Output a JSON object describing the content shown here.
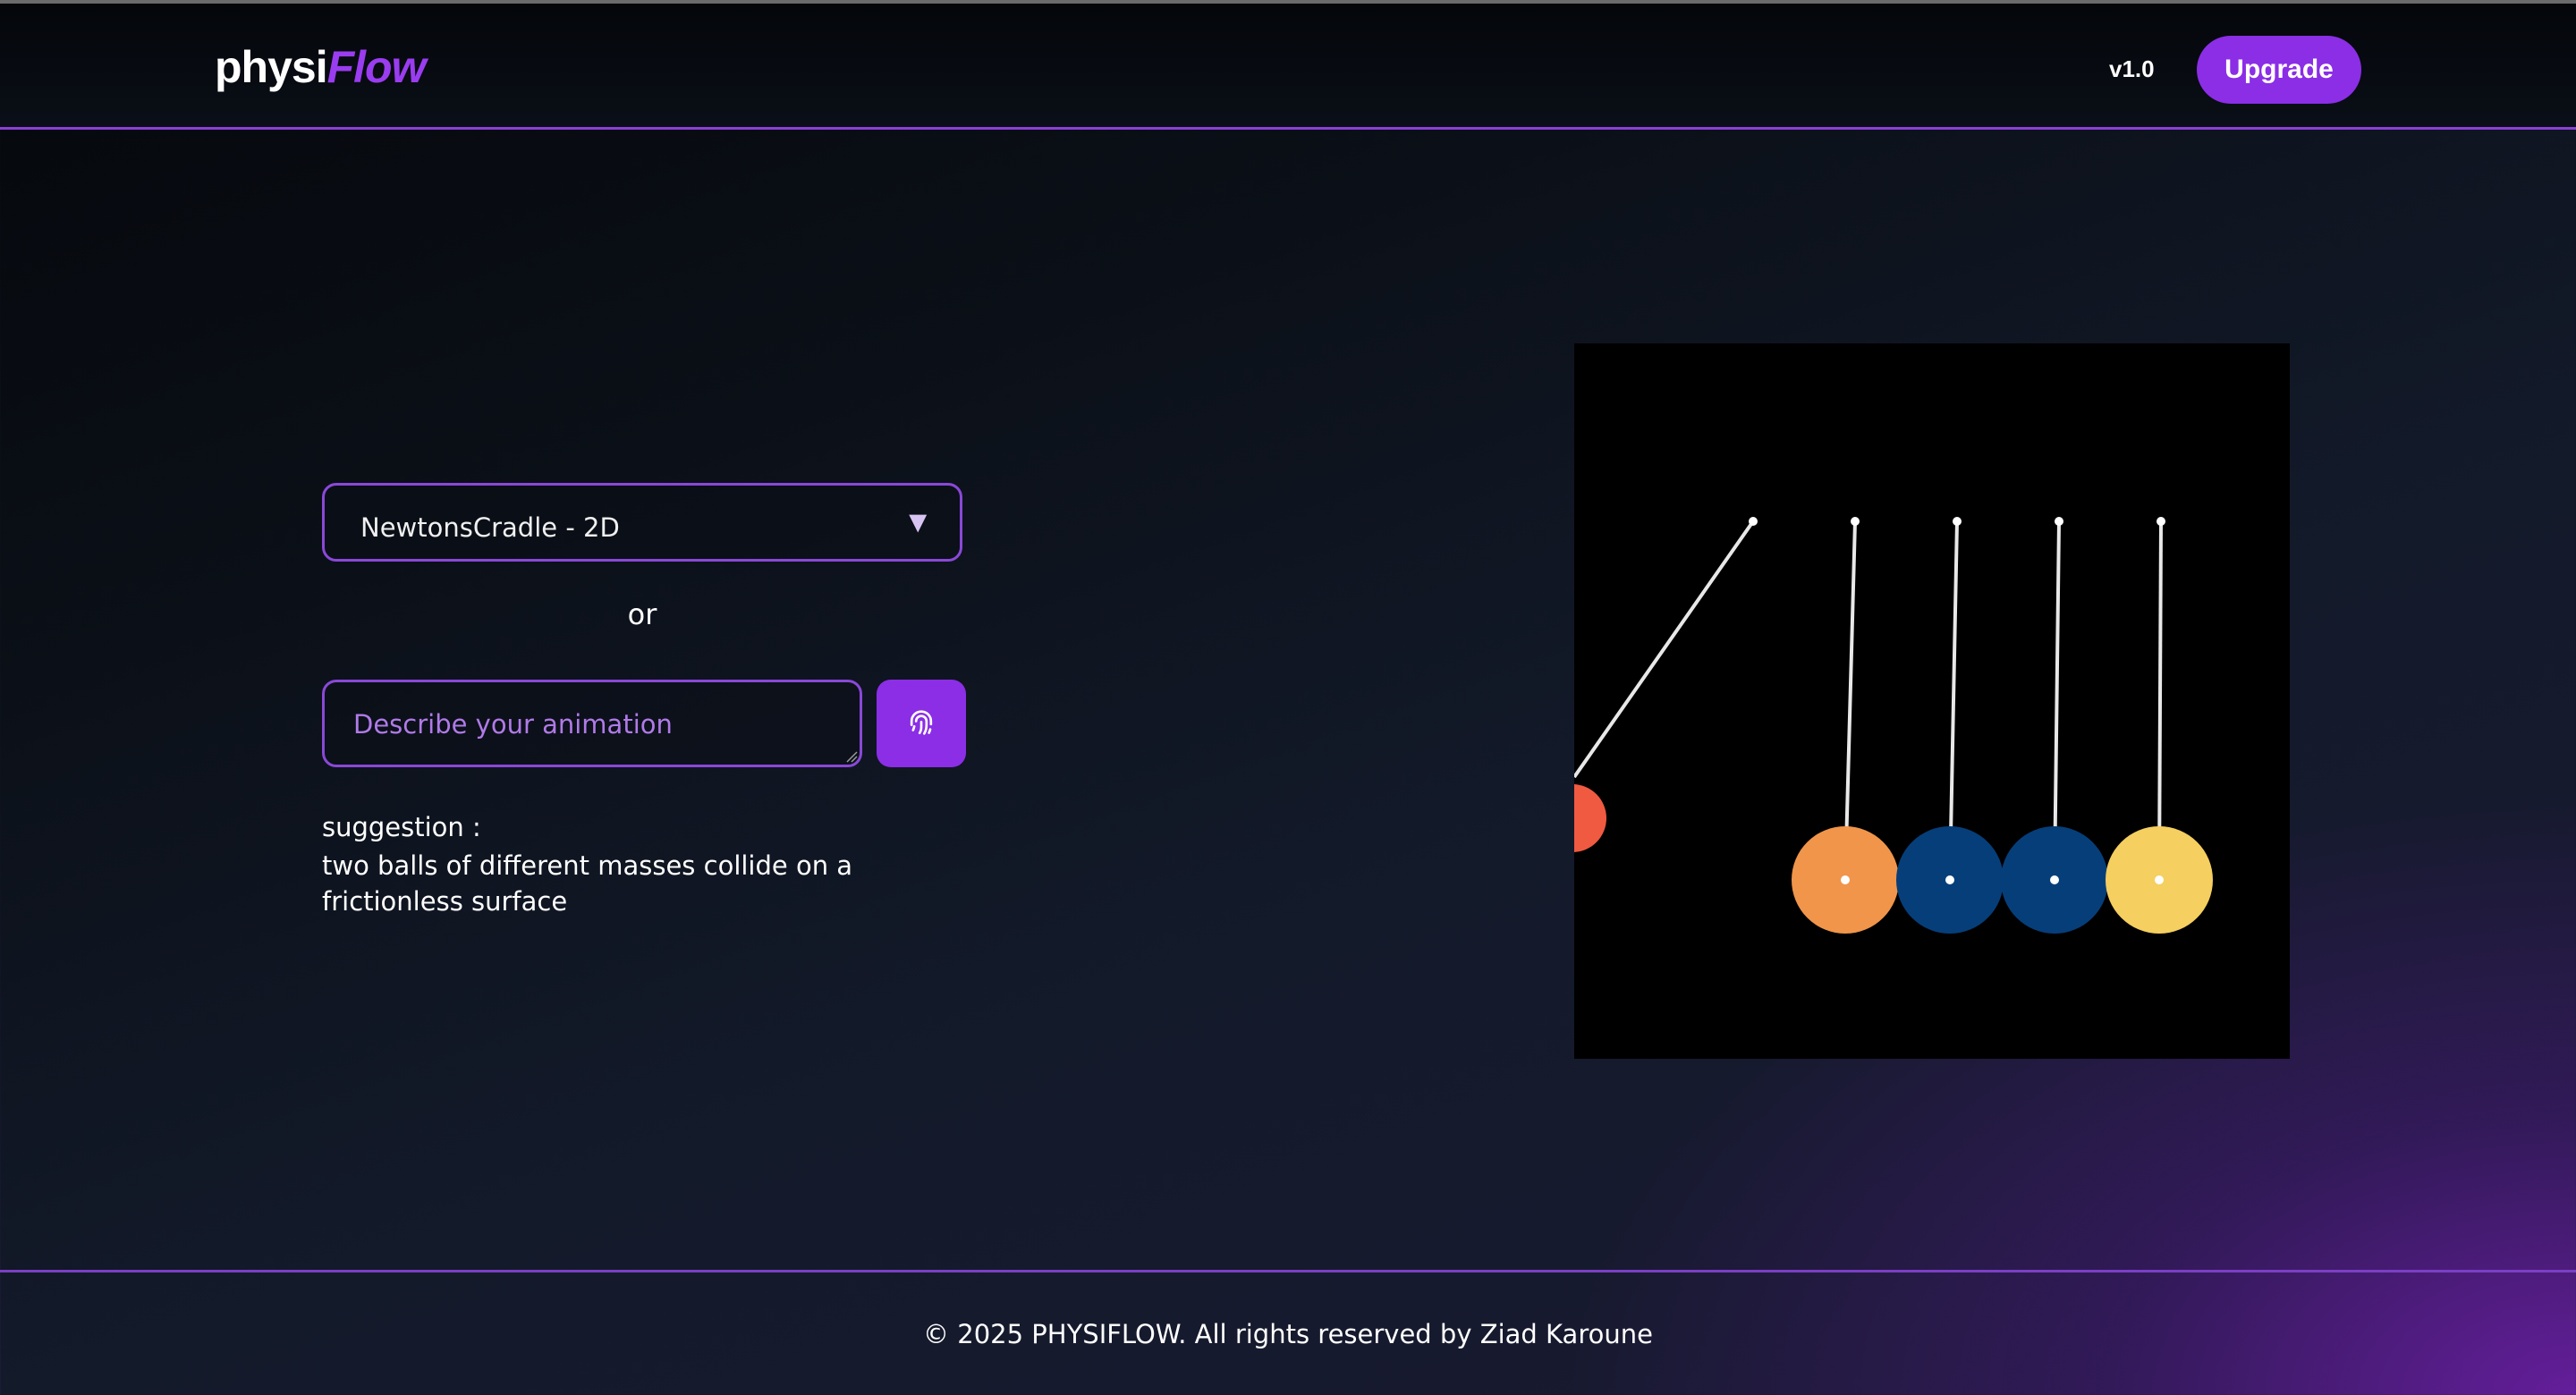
{
  "header": {
    "logo_part1": "physi",
    "logo_part2": "Flow",
    "version": "v1.0",
    "upgrade_label": "Upgrade"
  },
  "controls": {
    "selected_animation": "NewtonsCradle - 2D",
    "or_label": "or",
    "prompt_placeholder": "Describe your animation",
    "generate_icon": "fingerprint-icon",
    "suggestion_title": "suggestion :",
    "suggestion_text": "two balls of different masses collide on a frictionless surface"
  },
  "simulation": {
    "name": "newtons-cradle",
    "ball_colors": [
      "#f05a40",
      "#f0954a",
      "#063e7a",
      "#063e7a",
      "#f5cf5f"
    ]
  },
  "footer": {
    "prefix": "© 2025 PHYSIFLOW. All rights reserved by ",
    "author": "Ziad Karoune"
  },
  "colors": {
    "accent": "#8b2ee6",
    "border": "#8a48d8",
    "placeholder": "#b07ae8"
  }
}
